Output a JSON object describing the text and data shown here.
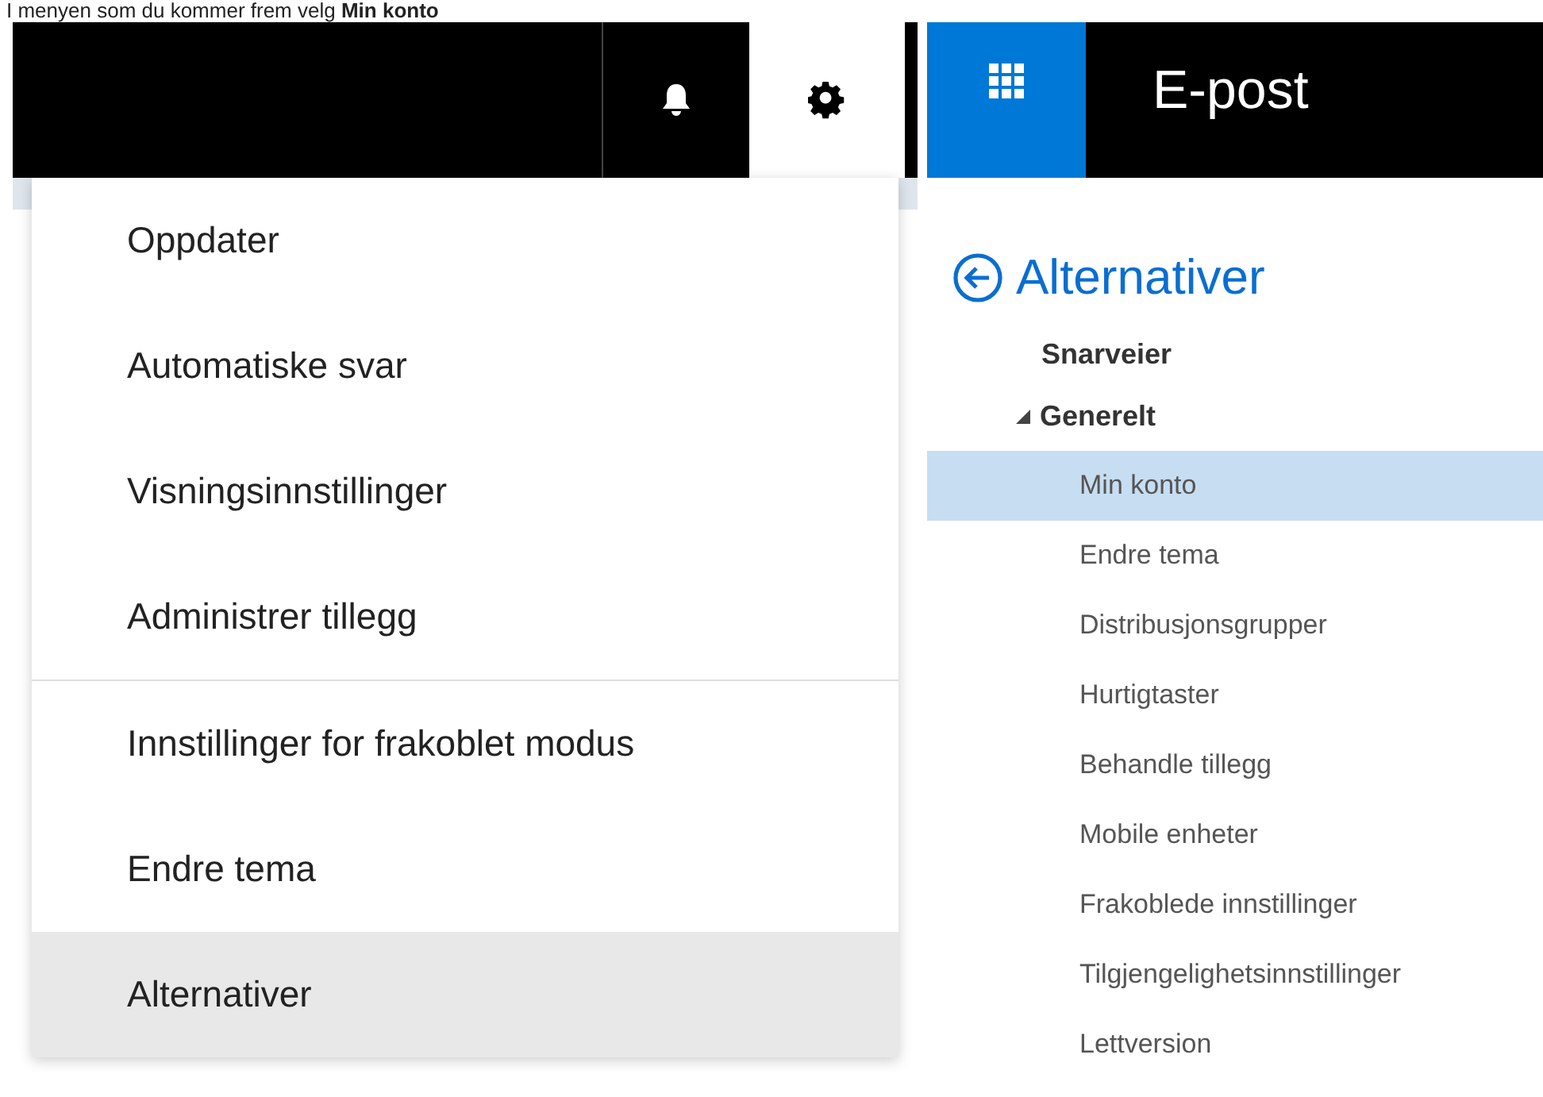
{
  "caption": "I menyen som du kommer frem velg **Min konto**",
  "top_bar": {
    "buttons": [
      {
        "kind": "notifications",
        "selected": false
      },
      {
        "kind": "settings",
        "selected": true
      }
    ]
  },
  "settings_menu": {
    "groups": [
      [
        {
          "label": "Oppdater",
          "selected": false
        },
        {
          "label": "Automatiske svar",
          "selected": false
        },
        {
          "label": "Visningsinnstillinger",
          "selected": false
        },
        {
          "label": "Administrer tillegg",
          "selected": false
        }
      ],
      [
        {
          "label": "Innstillinger for frakoblet modus",
          "selected": false
        },
        {
          "label": "Endre tema",
          "selected": false
        },
        {
          "label": "Alternativer",
          "selected": true
        }
      ]
    ]
  },
  "mail_header": {
    "title": "E-post"
  },
  "options_nav": {
    "title": "Alternativer",
    "items": [
      {
        "kind": "section",
        "label": "Snarveier"
      },
      {
        "kind": "group",
        "label": "Generelt",
        "expanded": true,
        "children": [
          {
            "label": "Min konto",
            "selected": true
          },
          {
            "label": "Endre tema",
            "selected": false
          },
          {
            "label": "Distribusjonsgrupper",
            "selected": false
          },
          {
            "label": "Hurtigtaster",
            "selected": false
          },
          {
            "label": "Behandle tillegg",
            "selected": false
          },
          {
            "label": "Mobile enheter",
            "selected": false
          },
          {
            "label": "Frakoblede innstillinger",
            "selected": false
          },
          {
            "label": "Tilgjengelighetsinnstillinger",
            "selected": false
          },
          {
            "label": "Lettversion",
            "selected": false
          }
        ]
      }
    ]
  }
}
